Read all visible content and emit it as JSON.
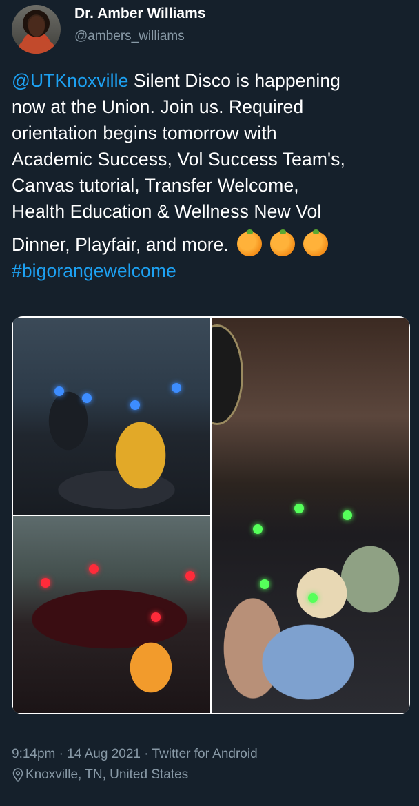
{
  "author": {
    "name": "Dr. Amber Williams",
    "handle": "@ambers_williams"
  },
  "tweet": {
    "mention": "@UTKnoxville",
    "line1_rest": " Silent Disco is happening",
    "line2": "now at the Union. Join us. Required",
    "line3": "orientation begins tomorrow with",
    "line4": "Academic Success, Vol Success Team's,",
    "line5": "Canvas tutorial, Transfer Welcome,",
    "line6": "Health Education & Wellness New Vol",
    "line7": "Dinner, Playfair, and more.",
    "emojis": [
      "orange-emoji",
      "orange-emoji",
      "orange-emoji"
    ],
    "hashtag": "#bigorangewelcome"
  },
  "meta": {
    "timestamp": "9:14pm · 14 Aug 2021 · Twitter for Android",
    "location": "Knoxville, TN, United States"
  },
  "colors": {
    "background": "#15202b",
    "link": "#1da1f2",
    "muted": "#8899a6"
  }
}
